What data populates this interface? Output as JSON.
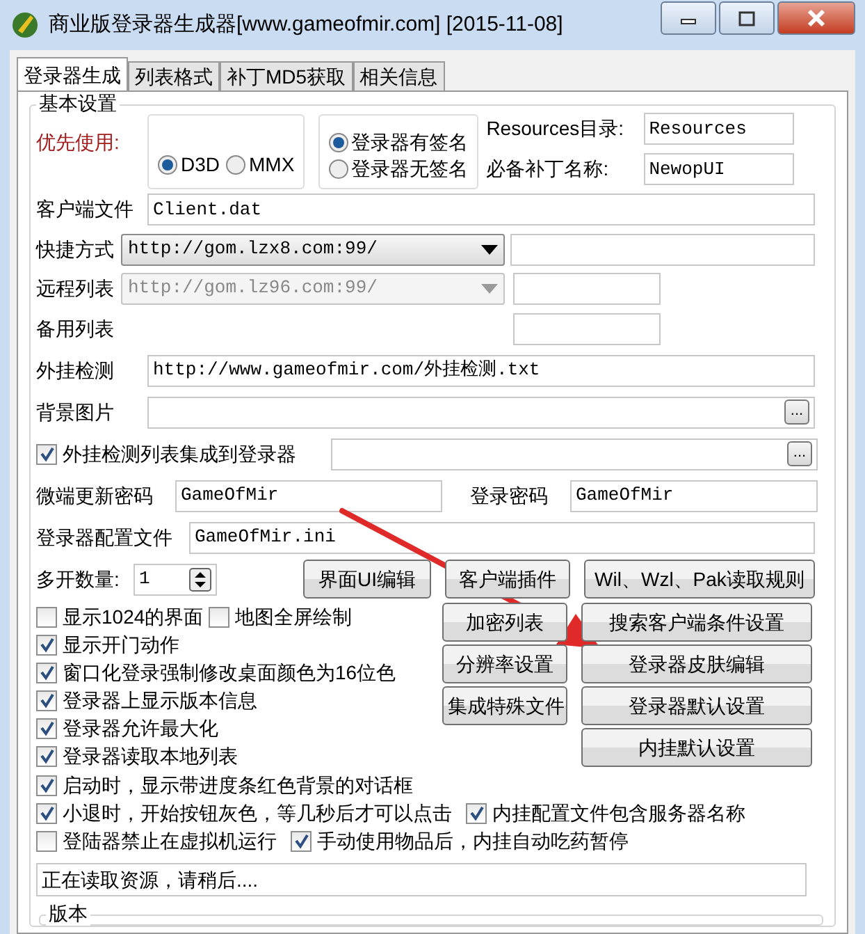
{
  "window": {
    "title": "商业版登录器生成器[www.gameofmir.com] [2015-11-08]"
  },
  "tabs": [
    {
      "label": "登录器生成",
      "selected": true
    },
    {
      "label": "列表格式",
      "selected": false
    },
    {
      "label": "补丁MD5获取",
      "selected": false
    },
    {
      "label": "相关信息",
      "selected": false
    }
  ],
  "group": {
    "title": "基本设置"
  },
  "prefer": {
    "label": "优先使用:",
    "options": [
      {
        "label": "D3D",
        "selected": true
      },
      {
        "label": "MMX",
        "selected": false
      }
    ]
  },
  "signature": {
    "options": [
      {
        "label": "登录器有签名",
        "selected": true
      },
      {
        "label": "登录器无签名",
        "selected": false
      }
    ]
  },
  "resources": {
    "label": "Resources目录:",
    "value": "Resources"
  },
  "patch": {
    "label": "必备补丁名称:",
    "value": "NewopUI"
  },
  "client_file": {
    "label": "客户端文件",
    "value": "Client.dat"
  },
  "shortcut": {
    "label": "快捷方式",
    "value": "http://gom.lzx8.com:99/",
    "disabled": false
  },
  "remote_list": {
    "label": "远程列表",
    "value": "http://gom.lz96.com:99/",
    "disabled": true
  },
  "backup_list": {
    "label": "备用列表"
  },
  "plugin_check": {
    "label": "外挂检测",
    "value": "http://www.gameofmir.com/外挂检测.txt"
  },
  "background": {
    "label": "背景图片",
    "browse": "..."
  },
  "integrate": {
    "label": "外挂检测列表集成到登录器",
    "checked": true,
    "browse": "..."
  },
  "micro_password": {
    "label": "微端更新密码",
    "value": "GameOfMir"
  },
  "login_password": {
    "label": "登录密码",
    "value": "GameOfMir"
  },
  "config_file": {
    "label": "登录器配置文件",
    "value": "GameOfMir.ini"
  },
  "multi_open": {
    "label": "多开数量:",
    "value": "1"
  },
  "top_buttons": [
    "界面UI编辑",
    "客户端插件",
    "Wil、Wzl、Pak读取规则"
  ],
  "middle_buttons": [
    "加密列表",
    "分辨率设置",
    "集成特殊文件"
  ],
  "right_buttons": [
    "搜索客户端条件设置",
    "登录器皮肤编辑",
    "登录器默认设置",
    "内挂默认设置"
  ],
  "options_left": [
    [
      {
        "label": "显示1024的界面",
        "checked": false
      },
      {
        "label": "地图全屏绘制",
        "checked": false
      }
    ],
    [
      {
        "label": "显示开门动作",
        "checked": true
      }
    ],
    [
      {
        "label": "窗口化登录强制修改桌面颜色为16位色",
        "checked": true
      }
    ],
    [
      {
        "label": "登录器上显示版本信息",
        "checked": true
      }
    ],
    [
      {
        "label": "登录器允许最大化",
        "checked": true
      }
    ],
    [
      {
        "label": "登录器读取本地列表",
        "checked": true
      }
    ]
  ],
  "options_full": [
    [
      {
        "label": "启动时，显示带进度条红色背景的对话框",
        "checked": true
      }
    ],
    [
      {
        "label": "小退时，开始按钮灰色，等几秒后才可以点击",
        "checked": true
      },
      {
        "label": "内挂配置文件包含服务器名称",
        "checked": true
      }
    ],
    [
      {
        "label": "登陆器禁止在虚拟机运行",
        "checked": false
      },
      {
        "label": "手动使用物品后，内挂自动吃药暂停",
        "checked": true
      }
    ]
  ],
  "status": "正在读取资源，请稍后....",
  "version_group": {
    "title": "版本"
  }
}
